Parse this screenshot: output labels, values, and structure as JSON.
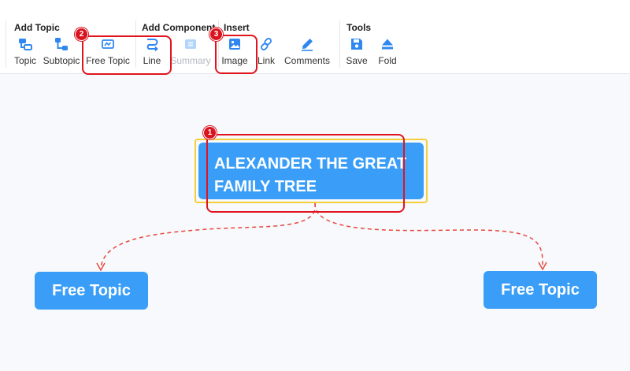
{
  "toolbar": {
    "groups": {
      "add_topic": "Add Topic",
      "add_component": "Add Component",
      "insert": "Insert",
      "tools": "Tools"
    },
    "buttons": {
      "topic": "Topic",
      "subtopic": "Subtopic",
      "free_topic": "Free Topic",
      "line": "Line",
      "summary": "Summary",
      "image": "Image",
      "link": "Link",
      "comments": "Comments",
      "save": "Save",
      "fold": "Fold"
    },
    "accent_color": "#2f88f0",
    "disabled_color": "#b4d6fb"
  },
  "annotations": {
    "step1": "1",
    "step2": "2",
    "step3": "3",
    "color": "#e0141e"
  },
  "canvas": {
    "root_topic": "ALEXANDER THE GREAT FAMILY TREE",
    "free_topic_left": "Free Topic",
    "free_topic_right": "Free Topic",
    "topic_color": "#3a9ef8",
    "connector_color": "#e5483f"
  }
}
